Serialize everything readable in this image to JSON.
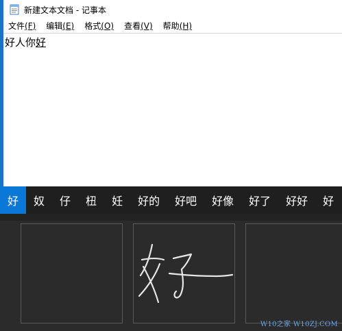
{
  "window": {
    "title": "新建文本文档 - 记事本",
    "accent_color": "#1a73c9"
  },
  "menu": [
    {
      "label": "文件",
      "hotkey": "(F)"
    },
    {
      "label": "编辑",
      "hotkey": "(E)"
    },
    {
      "label": "格式",
      "hotkey": "(O)"
    },
    {
      "label": "查看",
      "hotkey": "(V)"
    },
    {
      "label": "帮助",
      "hotkey": "(H)"
    }
  ],
  "editor": {
    "committed_text": "好人你",
    "composing_text": "好"
  },
  "ime": {
    "selected_color": "#0a78d7",
    "candidates": [
      "好",
      "奴",
      "仔",
      "杻",
      "妊",
      "好的",
      "好吧",
      "好像",
      "好了",
      "好好",
      "好"
    ]
  },
  "handwriting": {
    "icon": "handwriting-ink-stroke"
  },
  "watermark": "W10之家 W10ZJ.COM"
}
